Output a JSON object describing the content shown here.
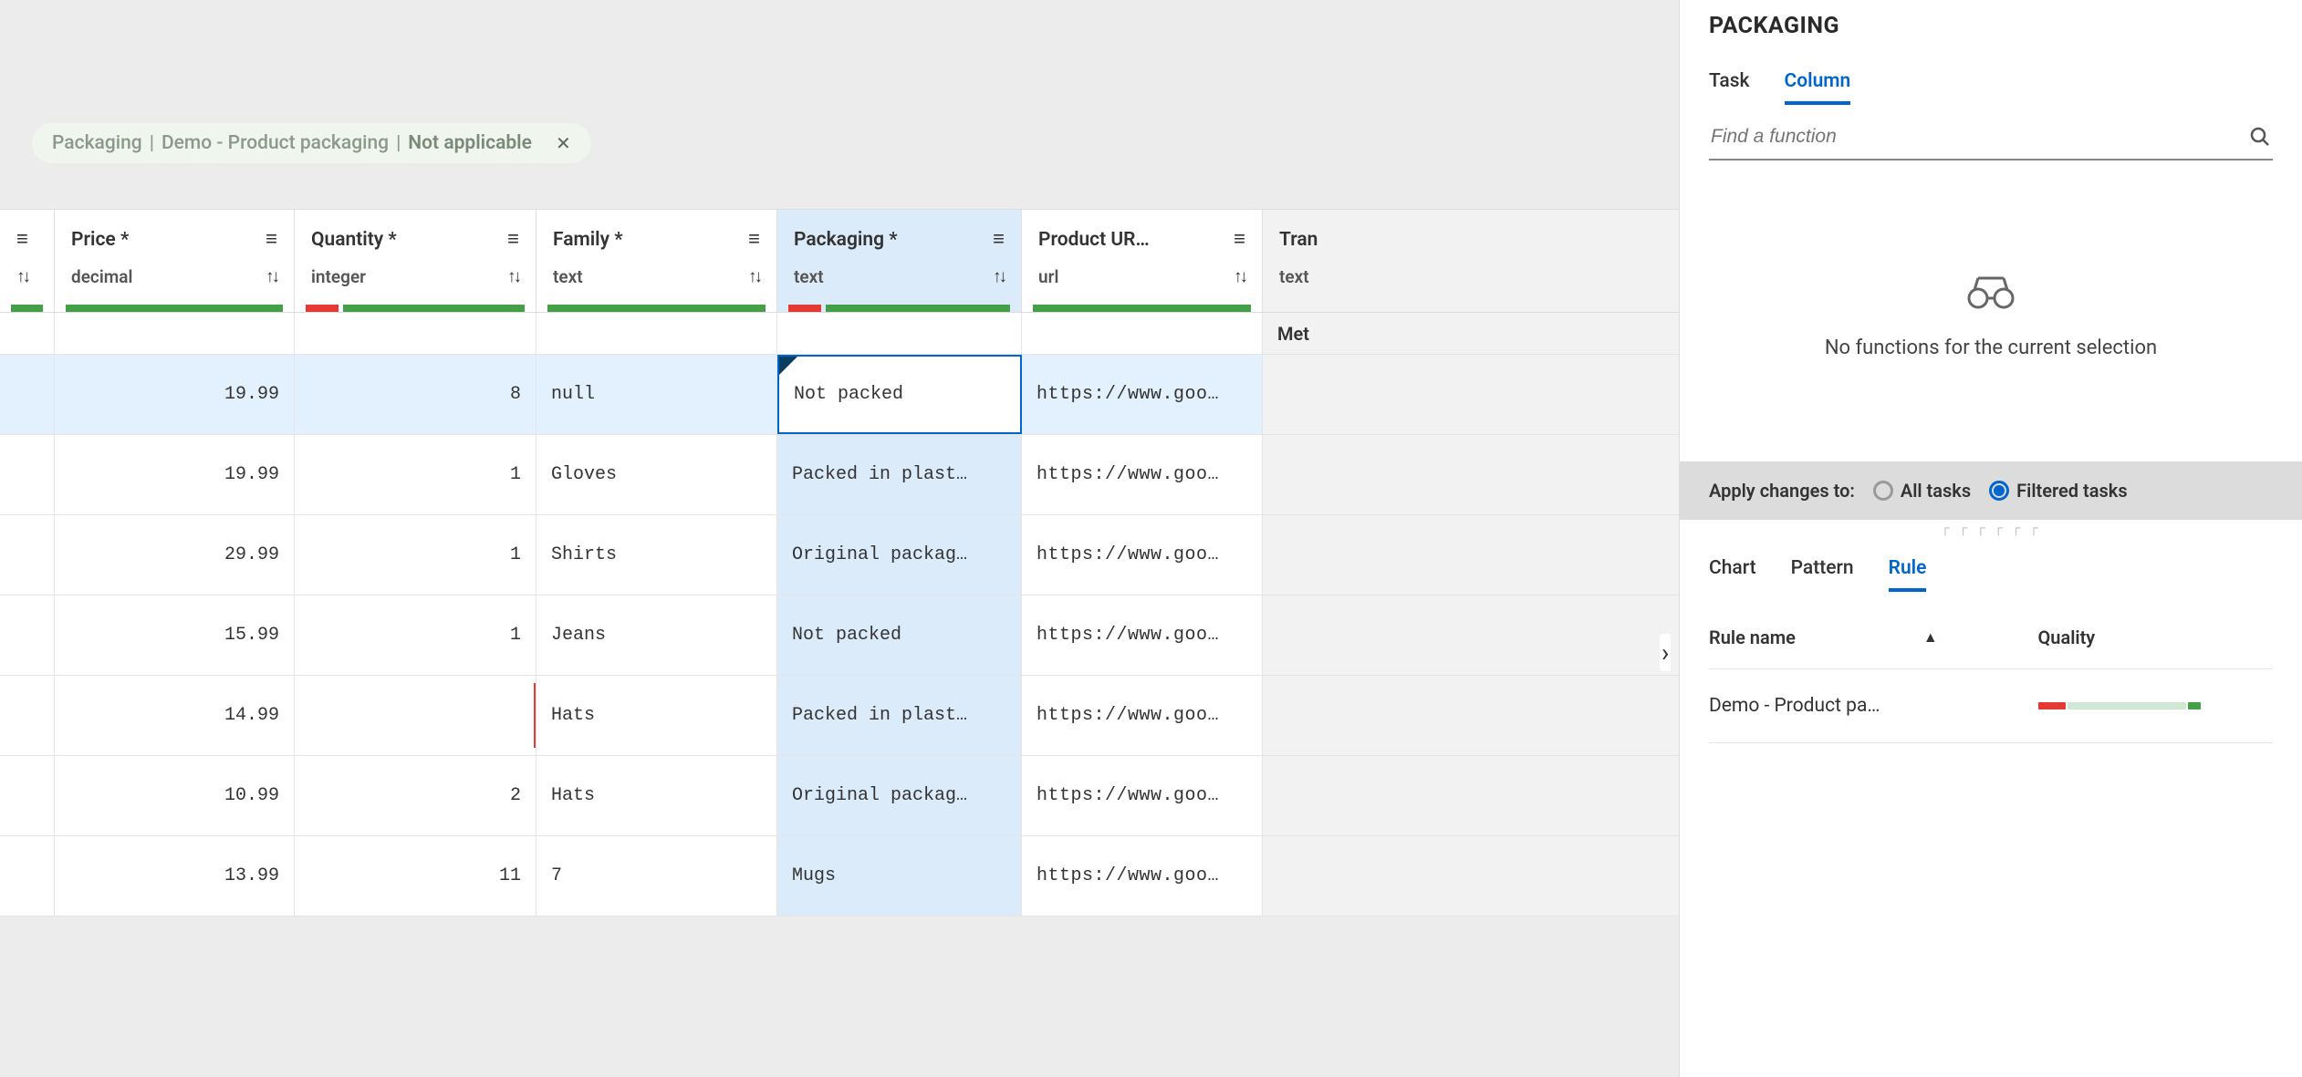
{
  "filter_chip": {
    "part1": "Packaging",
    "part2": "Demo - Product packaging",
    "part3": "Not applicable",
    "separator": "|",
    "close_glyph": "✕"
  },
  "columns": {
    "price": {
      "title": "Price *",
      "type": "decimal",
      "quality_red_pct": 0,
      "quality_green_pct": 100
    },
    "qty": {
      "title": "Quantity *",
      "type": "integer",
      "quality_red_pct": 15,
      "quality_green_pct": 85
    },
    "family": {
      "title": "Family *",
      "type": "text",
      "quality_red_pct": 0,
      "quality_green_pct": 100
    },
    "pack": {
      "title": "Packaging *",
      "type": "text",
      "quality_red_pct": 15,
      "quality_green_pct": 85
    },
    "url": {
      "title": "Product UR…",
      "type": "url",
      "quality_red_pct": 0,
      "quality_green_pct": 100
    },
    "tran": {
      "title": "Tran",
      "type": "text",
      "meta_label": "Met"
    }
  },
  "edit_value": "Not packed",
  "rows": [
    {
      "price": "19.99",
      "qty": "8",
      "family": "null",
      "pack": "Not packed",
      "url": "https://www.goo…",
      "selected": true,
      "edit": true
    },
    {
      "price": "19.99",
      "qty": "1",
      "family": "Gloves",
      "pack": "Packed in plast…",
      "url": "https://www.goo…"
    },
    {
      "price": "29.99",
      "qty": "1",
      "family": "Shirts",
      "pack": "Original packag…",
      "url": "https://www.goo…"
    },
    {
      "price": "15.99",
      "qty": "1",
      "family": "Jeans",
      "pack": "Not packed",
      "url": "https://www.goo…"
    },
    {
      "price": "14.99",
      "qty": "",
      "family": "Hats",
      "pack": "Packed in plast…",
      "url": "https://www.goo…",
      "qty_invalid": true
    },
    {
      "price": "10.99",
      "qty": "2",
      "family": "Hats",
      "pack": "Original packag…",
      "url": "https://www.goo…"
    },
    {
      "price": "13.99",
      "qty": "11",
      "family": "7",
      "pack": "Mugs",
      "url": "https://www.goo…"
    }
  ],
  "sidebar": {
    "title": "PACKAGING",
    "tabs": {
      "task": "Task",
      "column": "Column"
    },
    "search_placeholder": "Find a function",
    "no_functions": "No functions for the current selection",
    "apply_label": "Apply changes to:",
    "radio_all": "All tasks",
    "radio_filtered": "Filtered tasks",
    "lower_tabs": {
      "chart": "Chart",
      "pattern": "Pattern",
      "rule": "Rule"
    },
    "rule_table": {
      "head_name": "Rule name",
      "head_quality": "Quality",
      "rows": [
        {
          "name": "Demo - Product pa…"
        }
      ]
    }
  },
  "icons": {
    "hamburger": "≡",
    "sort": "↑↓",
    "search": "🔍",
    "binoculars": "👓",
    "chevron_right": "›",
    "caret_up": "▲"
  }
}
